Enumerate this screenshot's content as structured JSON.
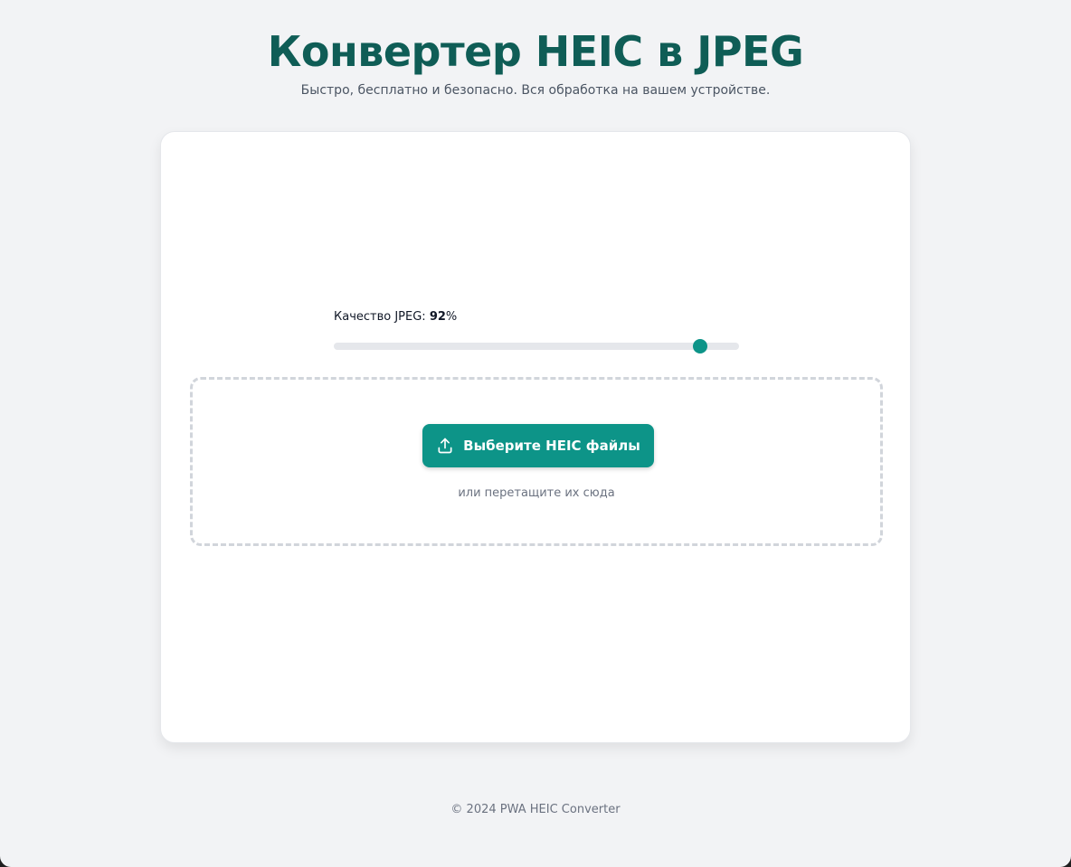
{
  "header": {
    "title": "Конвертер HEIC в JPEG",
    "subtitle": "Быстро, бесплатно и безопасно. Вся обработка на вашем устройстве."
  },
  "quality": {
    "label": "Качество JPEG: ",
    "value": "92",
    "unit": "%",
    "percent": 92,
    "min": 0,
    "max": 100
  },
  "dropzone": {
    "button_label": "Выберите HEIC файлы",
    "button_icon": "upload-icon",
    "hint": "или перетащите их сюда"
  },
  "footer": {
    "text": "© 2024 PWA HEIC Converter"
  },
  "colors": {
    "accent": "#0d9488",
    "title": "#0f5d56",
    "background": "#f2f3f5"
  }
}
